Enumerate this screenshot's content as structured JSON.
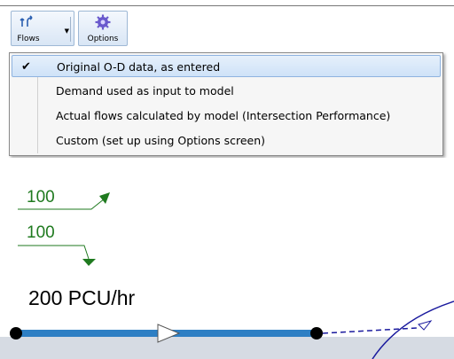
{
  "toolbar": {
    "flows_label": "Flows",
    "options_label": "Options"
  },
  "flows_menu": {
    "items": [
      {
        "label": "Original O-D data, as entered",
        "checked": true
      },
      {
        "label": "Demand used as input to model",
        "checked": false
      },
      {
        "label": "Actual flows calculated by model (Intersection Performance)",
        "checked": false
      },
      {
        "label": "Custom (set up using Options screen)",
        "checked": false
      }
    ],
    "check_glyph": "✔"
  },
  "diagram": {
    "flow_1": "100",
    "flow_2": "100",
    "pcu_label": "200 PCU/hr"
  },
  "colors": {
    "flow_text": "#1f7a1f",
    "link_blue": "#2e7fc4",
    "node_black": "#000000",
    "arc_navy": "#1a1a9e"
  }
}
